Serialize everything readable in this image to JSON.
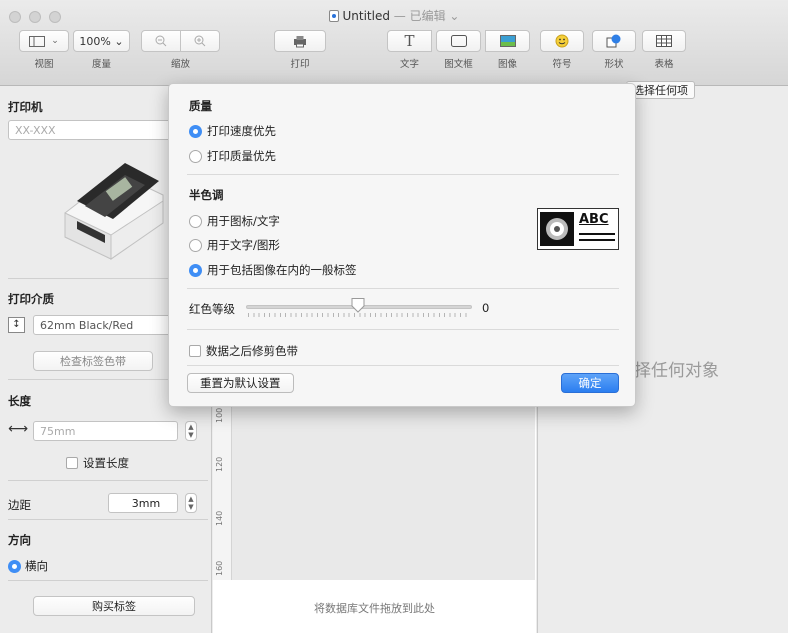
{
  "window": {
    "title": "Untitled",
    "title_suffix": "— 已编辑 ⌄"
  },
  "toolbar": {
    "view_label": "视图",
    "zoom_value": "100% ⌄",
    "zoom_label": "度量",
    "scale_label": "缩放",
    "print_label": "打印",
    "text_label": "文字",
    "textbox_label": "图文框",
    "image_label": "图像",
    "symbol_label": "符号",
    "shape_label": "形状",
    "table_label": "表格"
  },
  "sidebar": {
    "printer_title": "打印机",
    "printer_value": "XX-XXX",
    "media_title": "打印介质",
    "media_value": "62mm Black/Red",
    "check_media_button": "检查标签色带",
    "length_title": "长度",
    "length_value": "75mm",
    "set_length_label": "设置长度",
    "margin_label": "边距",
    "margin_value": "3mm",
    "direction_title": "方向",
    "direction_value": "横向",
    "buy_button": "购买标签"
  },
  "canvas": {
    "ruler_marks": [
      "100",
      "120",
      "140",
      "160"
    ],
    "drop_hint": "将数据库文件拖放到此处"
  },
  "right_panel": {
    "select_button": "选择任何项",
    "no_selection_text": "择任何对象"
  },
  "popover": {
    "quality_title": "质量",
    "quality_options": [
      "打印速度优先",
      "打印质量优先"
    ],
    "quality_selected": 0,
    "halftone_title": "半色调",
    "halftone_options": [
      "用于图标/文字",
      "用于文字/图形",
      "用于包括图像在内的一般标签"
    ],
    "halftone_selected": 2,
    "preview_text": "ABC",
    "red_level_label": "红色等级",
    "red_level_value": "0",
    "trim_label": "数据之后修剪色带",
    "reset_button": "重置为默认设置",
    "ok_button": "确定"
  },
  "colors": {
    "accent": "#2b7ef0",
    "radio_selected": "#3f8ef5"
  }
}
